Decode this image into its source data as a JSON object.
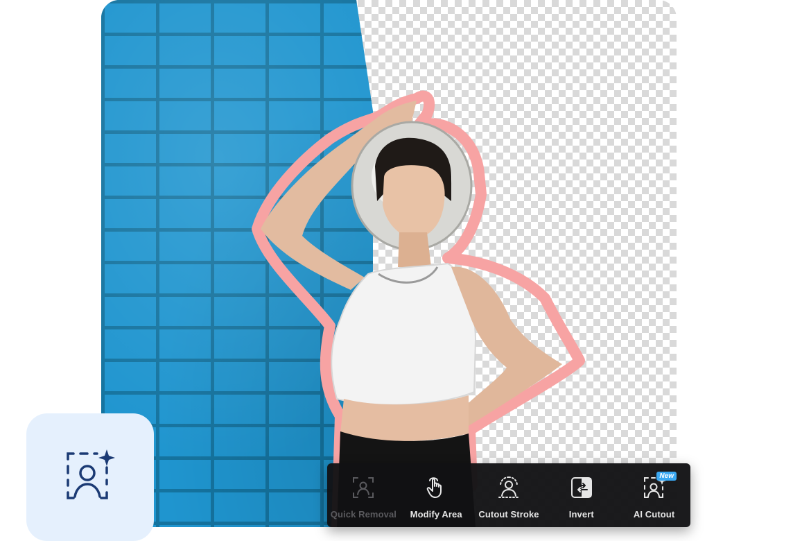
{
  "toolbar": {
    "tools": [
      {
        "label": "Quick Removal",
        "icon": "portrait-select-icon",
        "state": "disabled"
      },
      {
        "label": "Modify Area",
        "icon": "pointer-hand-icon",
        "state": "active"
      },
      {
        "label": "Cutout Stroke",
        "icon": "person-stroke-icon",
        "state": "active"
      },
      {
        "label": "Invert",
        "icon": "invert-icon",
        "state": "active"
      },
      {
        "label": "AI Cutout",
        "icon": "ai-portrait-select-icon",
        "state": "active",
        "badge": "New"
      }
    ]
  },
  "badge": {
    "icon": "ai-portrait-select-icon"
  },
  "colors": {
    "brick": "#1f95cf",
    "stroke": "#f4a0a0",
    "badge_bg": "#e5f0fd",
    "badge_icon": "#1b3a74",
    "toolbar_bg": "#121214",
    "new_badge": "#3aa8f2"
  }
}
